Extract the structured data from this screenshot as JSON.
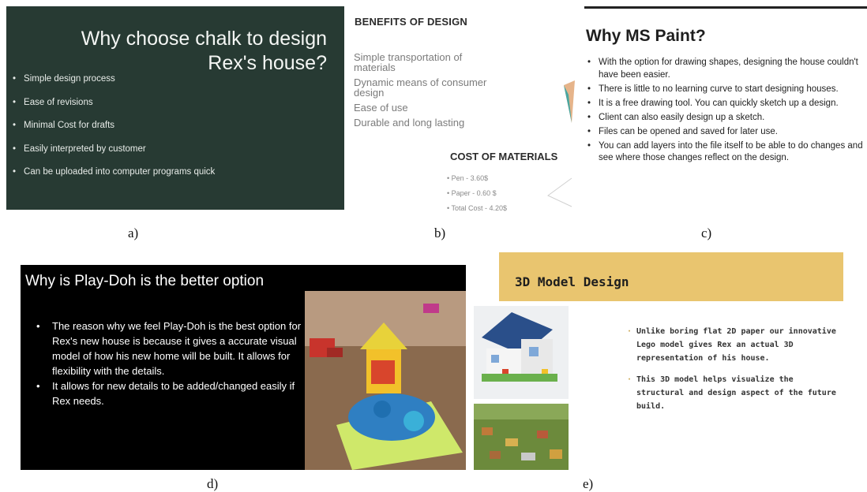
{
  "panel_a": {
    "title": "Why choose chalk to design Rex's house?",
    "bullets": [
      "Simple design process",
      "Ease of revisions",
      "Minimal Cost for drafts",
      "Easily interpreted by customer",
      "Can be uploaded into computer programs quick"
    ],
    "caption": "a)"
  },
  "panel_b": {
    "benefits_title": "BENEFITS OF DESIGN",
    "benefits": [
      "Simple transportation of materials",
      "Dynamic means of consumer design",
      "Ease of use",
      "Durable and long lasting"
    ],
    "cost_title": "COST OF MATERIALS",
    "costs": [
      "• Pen - 3.60$",
      "• Paper - 0.60 $",
      "• Total Cost - 4.20$"
    ],
    "caption": "b)"
  },
  "panel_c": {
    "title": "Why MS Paint?",
    "bullets": [
      "With the option for drawing shapes, designing the house couldn't have been easier.",
      "There is little to no learning curve to start designing houses.",
      "It is a free drawing tool. You can quickly sketch up a design.",
      "Client can also easily design up a sketch.",
      "Files can be opened and saved for later use.",
      "You can add layers into the file itself to be able to do changes and see where those changes reflect on the design."
    ],
    "caption": "c)"
  },
  "panel_d": {
    "title": "Why is Play-Doh is the better option",
    "bullets": [
      "The reason why we feel Play-Doh is the best option for Rex's new house is because it gives a accurate visual model of how his new home will be built. It allows for flexibility with the details.",
      "It allows for new details to be added/changed easily if Rex needs."
    ],
    "caption": "d)"
  },
  "panel_e": {
    "title": "3D Model Design",
    "bullets": [
      "Unlike boring flat 2D paper our innovative Lego model gives Rex an actual 3D representation of his house.",
      "This 3D model helps visualize the structural and design aspect of the future build."
    ],
    "caption": "e)"
  }
}
